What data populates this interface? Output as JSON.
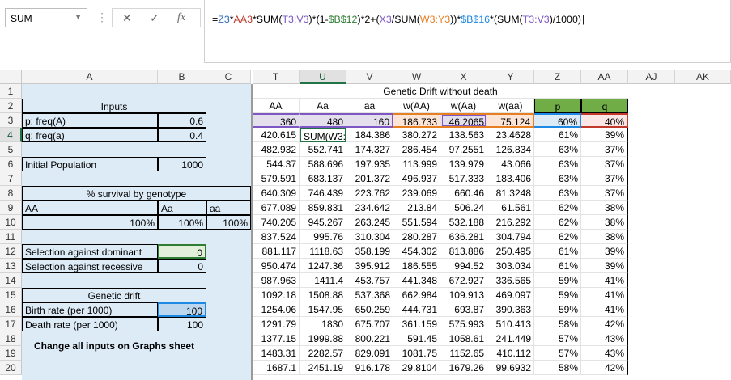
{
  "name_box": "SUM",
  "formula_buttons": {
    "cancel": "✕",
    "enter": "✓",
    "fx": "fx"
  },
  "formula": [
    {
      "t": "=",
      "c": "#000"
    },
    {
      "t": "Z3",
      "c": "#2f6eba"
    },
    {
      "t": "*",
      "c": "#000"
    },
    {
      "t": "AA3",
      "c": "#c0392b"
    },
    {
      "t": "*SUM(",
      "c": "#000"
    },
    {
      "t": "T3:V3",
      "c": "#7e57c2"
    },
    {
      "t": ")*(1-",
      "c": "#000"
    },
    {
      "t": "$B$12",
      "c": "#2e7d32"
    },
    {
      "t": ")*2+(",
      "c": "#000"
    },
    {
      "t": "X3",
      "c": "#7e57c2"
    },
    {
      "t": "/SUM(",
      "c": "#000"
    },
    {
      "t": "W3:Y3",
      "c": "#e67e22"
    },
    {
      "t": "))*",
      "c": "#000"
    },
    {
      "t": "$B$16",
      "c": "#1e88e5"
    },
    {
      "t": "*(SUM(",
      "c": "#000"
    },
    {
      "t": "T3:V3",
      "c": "#7e57c2"
    },
    {
      "t": ")/1000)",
      "c": "#000"
    }
  ],
  "columns": [
    "A",
    "B",
    "C",
    "T",
    "U",
    "V",
    "W",
    "X",
    "Y",
    "Z",
    "AA",
    "AJ",
    "AK"
  ],
  "selected_column": "U",
  "selected_row": "4",
  "rows": [
    "1",
    "2",
    "3",
    "4",
    "5",
    "6",
    "7",
    "8",
    "9",
    "10",
    "11",
    "12",
    "13",
    "14",
    "15",
    "16",
    "17",
    "18",
    "19",
    "20"
  ],
  "left_panel": {
    "inputs_title": "Inputs",
    "p_label": "p: freq(A)",
    "p_value": "0.6",
    "q_label": "q: freq(a)",
    "q_value": "0.4",
    "init_pop_label": "Initial Population",
    "init_pop_value": "1000",
    "survival_title": "% survival by genotype",
    "geno_AA": "AA",
    "geno_Aa": "Aa",
    "geno_aa": "aa",
    "surv_AA": "100%",
    "surv_Aa": "100%",
    "surv_aa": "100%",
    "sel_dom_label": "Selection against dominant",
    "sel_dom_value": "0",
    "sel_rec_label": "Selection against recessive",
    "sel_rec_value": "0",
    "drift_title": "Genetic drift",
    "birth_label": "Birth rate (per 1000)",
    "birth_value": "100",
    "death_label": "Death rate (per 1000)",
    "death_value": "100",
    "note": "Change all inputs on Graphs sheet"
  },
  "table_title": "Genetic Drift without death",
  "table_headers": [
    "AA",
    "Aa",
    "aa",
    "w(AA)",
    "w(Aa)",
    "w(aa)",
    "p",
    "q"
  ],
  "table_rows": [
    [
      "360",
      "480",
      "160",
      "186.733",
      "46.2065",
      "75.124",
      "60%",
      "40%"
    ],
    [
      "420.615",
      "SUM(W3:",
      "184.386",
      "380.272",
      "138.563",
      "23.4628",
      "61%",
      "39%"
    ],
    [
      "482.932",
      "552.741",
      "174.327",
      "286.454",
      "97.2551",
      "126.834",
      "63%",
      "37%"
    ],
    [
      "544.37",
      "588.696",
      "197.935",
      "113.999",
      "139.979",
      "43.066",
      "63%",
      "37%"
    ],
    [
      "579.591",
      "683.137",
      "201.372",
      "496.937",
      "517.333",
      "183.406",
      "63%",
      "37%"
    ],
    [
      "640.309",
      "746.439",
      "223.762",
      "239.069",
      "660.46",
      "81.3248",
      "63%",
      "37%"
    ],
    [
      "677.089",
      "859.831",
      "234.642",
      "213.84",
      "506.24",
      "61.561",
      "62%",
      "38%"
    ],
    [
      "740.205",
      "945.267",
      "263.245",
      "551.594",
      "532.188",
      "216.292",
      "62%",
      "38%"
    ],
    [
      "837.524",
      "995.76",
      "310.304",
      "280.287",
      "636.281",
      "304.794",
      "62%",
      "38%"
    ],
    [
      "881.117",
      "1118.63",
      "358.199",
      "454.302",
      "813.886",
      "250.495",
      "61%",
      "39%"
    ],
    [
      "950.474",
      "1247.36",
      "395.912",
      "186.555",
      "994.52",
      "303.034",
      "61%",
      "39%"
    ],
    [
      "987.963",
      "1411.4",
      "453.757",
      "441.348",
      "672.927",
      "336.565",
      "59%",
      "41%"
    ],
    [
      "1092.18",
      "1508.88",
      "537.368",
      "662.984",
      "109.913",
      "469.097",
      "59%",
      "41%"
    ],
    [
      "1254.06",
      "1547.95",
      "650.259",
      "444.731",
      "693.87",
      "390.363",
      "59%",
      "41%"
    ],
    [
      "1291.79",
      "1830",
      "675.707",
      "361.159",
      "575.993",
      "510.413",
      "58%",
      "42%"
    ],
    [
      "1377.15",
      "1999.88",
      "800.221",
      "591.45",
      "1058.61",
      "241.449",
      "57%",
      "43%"
    ],
    [
      "1483.31",
      "2282.57",
      "829.091",
      "1081.75",
      "1152.65",
      "410.112",
      "57%",
      "43%"
    ],
    [
      "1687.1",
      "2451.19",
      "916.178",
      "29.8104",
      "1679.26",
      "99.6932",
      "58%",
      "42%"
    ]
  ]
}
